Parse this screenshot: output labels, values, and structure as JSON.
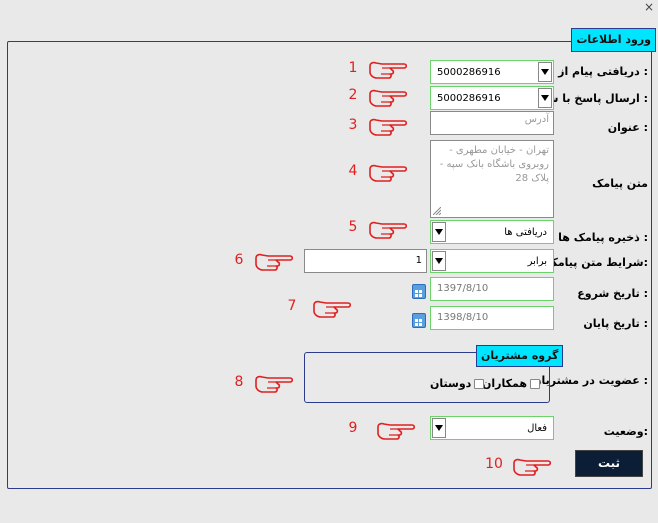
{
  "window": {
    "close_glyph": "×"
  },
  "form": {
    "legend": "ورود اطلاعات",
    "receive_label": "دریافتی پیام از شماره :",
    "receive_value": "5000286916",
    "send_label": "ارسال پاسخ با شماره :",
    "send_value": "5000286916",
    "title_label": "عنوان :",
    "title_placeholder": "آدرس",
    "message_label": "متن پیامک",
    "message_value": "تهران - خیابان مطهری - روبروی باشگاه بانک سپه - پلاک 28",
    "save_label": "ذخیره پیامک ها در :",
    "save_value": "دریافتی ها",
    "condition_label": "شرایط متن پیامک:",
    "condition_value": "برابر",
    "condition_count": "1",
    "start_label": "تاریخ شروع :",
    "start_value": "1397/8/10",
    "end_label": "تاریخ پایان :",
    "end_value": "1398/8/10",
    "membership_label": "عضویت در مشتریان :",
    "group_legend": "گروه مشتریان",
    "colleagues": "همکاران",
    "friends": "دوستان",
    "status_label": "وضعیت:",
    "status_value": "فعال",
    "submit_label": "ثبت"
  },
  "markers": [
    "1",
    "2",
    "3",
    "4",
    "5",
    "6",
    "7",
    "8",
    "9",
    "10"
  ],
  "colors": {
    "accent": "#00e5ff",
    "border": "#2c3c8c",
    "marker": "#e02020",
    "submit_bg": "#0c1d36"
  }
}
